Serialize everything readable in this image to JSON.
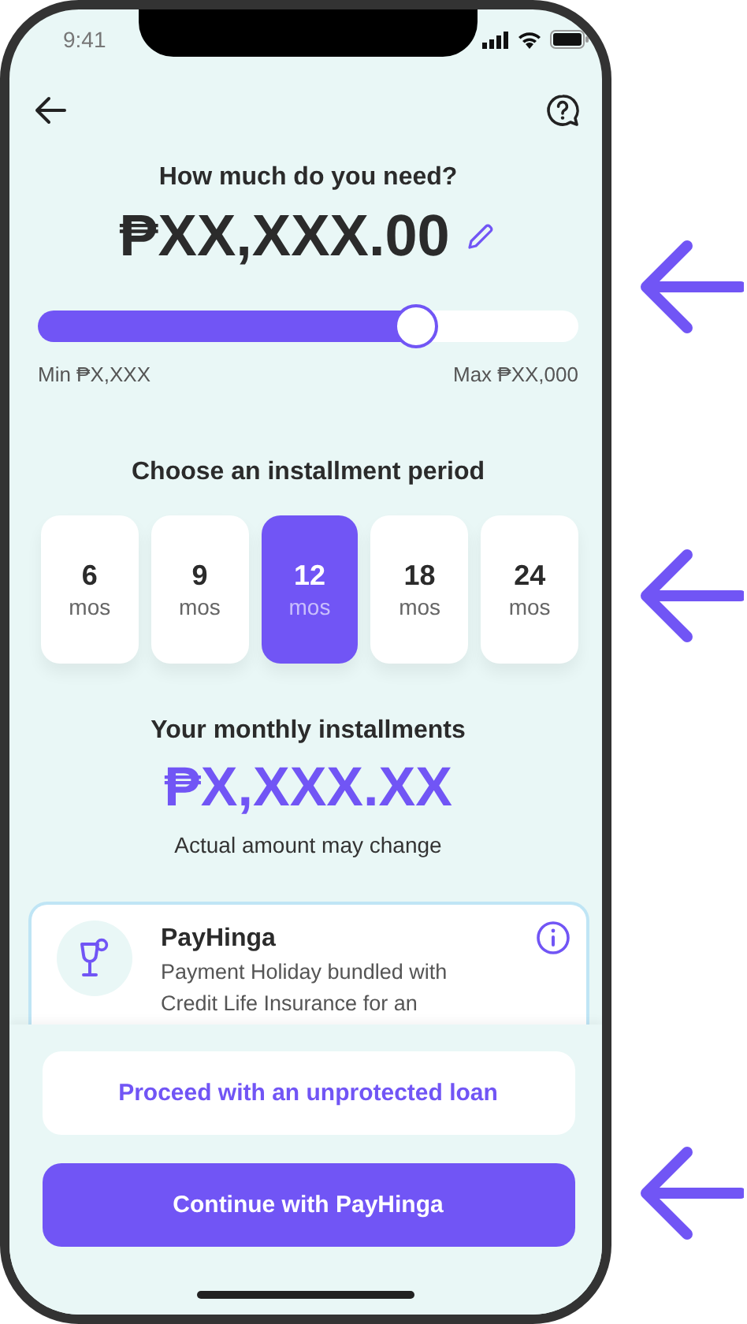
{
  "status_bar": {
    "time": "9:41"
  },
  "amount_section": {
    "title": "How much do you need?",
    "amount": "₱XX,XXX.00",
    "slider": {
      "level": 0.7
    },
    "min_label": "Min ₱X,XXX",
    "max_label": "Max ₱XX,000"
  },
  "period_section": {
    "title": "Choose an installment period",
    "periods": [
      {
        "value": "6",
        "unit": "mos",
        "selected": false
      },
      {
        "value": "9",
        "unit": "mos",
        "selected": false
      },
      {
        "value": "12",
        "unit": "mos",
        "selected": true
      },
      {
        "value": "18",
        "unit": "mos",
        "selected": false
      },
      {
        "value": "24",
        "unit": "mos",
        "selected": false
      }
    ]
  },
  "monthly_section": {
    "title": "Your monthly installments",
    "amount": "₱X,XXX.XX",
    "note": "Actual amount may change"
  },
  "protection_card": {
    "title": "PayHinga",
    "description": "Payment Holiday bundled with Credit Life Insurance for an"
  },
  "buttons": [
    {
      "kind": "secondary",
      "label": "Proceed with an unprotected loan"
    },
    {
      "kind": "primary",
      "label": "Continue with PayHinga"
    }
  ],
  "annotations": [
    {
      "kind": "arrow"
    },
    {
      "kind": "arrow"
    },
    {
      "kind": "arrow"
    }
  ]
}
